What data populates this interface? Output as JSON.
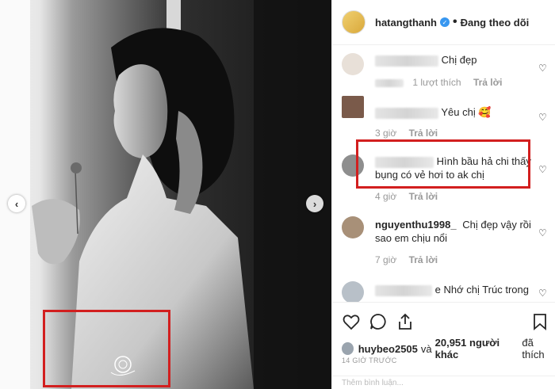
{
  "post": {
    "username": "hatangthanh",
    "verified_icon": "verified-badge-icon",
    "separator": "•",
    "follow_state": "Đang theo dõi"
  },
  "photo": {
    "prev_icon": "chevron-left-icon",
    "next_icon": "chevron-right-icon",
    "prev_glyph": "‹",
    "next_glyph": "›"
  },
  "comments": [
    {
      "user": "",
      "text": "Chị đẹp",
      "meta_a": "",
      "meta_b": "1 lượt thích",
      "reply": "Trả lời"
    },
    {
      "user": "",
      "text": "Yêu chị 🥰",
      "meta_a": "3 giờ",
      "meta_b": "",
      "reply": "Trả lời"
    },
    {
      "user": "",
      "text": "Hình bầu hả chi thấy bụng có vẻ hơi to ak chị",
      "meta_a": "4 giờ",
      "meta_b": "",
      "reply": "Trả lời"
    },
    {
      "user": "nguyenthu1998_",
      "text": "Chị đẹp vậy rồi sao em chịu nổi",
      "meta_a": "7 giờ",
      "meta_b": "",
      "reply": "Trả lời"
    },
    {
      "user": "",
      "text": "e Nhớ chị Trúc trong",
      "meta_a": "",
      "meta_b": "",
      "reply": ""
    }
  ],
  "likes": {
    "user": "huybeo2505",
    "joiner": "và",
    "count_text": "20,951 người khác",
    "suffix": "đã thích"
  },
  "timestamp": "14 GIỜ TRƯỚC",
  "add_comment_placeholder": "Thêm bình luận...",
  "colors": {
    "highlight": "#d21f1f",
    "verified": "#3897f0",
    "meta": "#999999"
  }
}
